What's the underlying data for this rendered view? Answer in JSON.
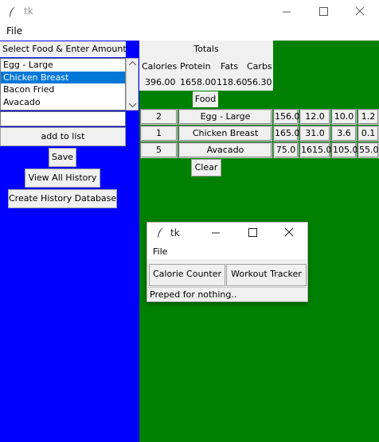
{
  "window": {
    "title": "tk",
    "menu_file": "File"
  },
  "left_panel": {
    "header": "Select Food & Enter Amount",
    "food_options": [
      "Egg - Large",
      "Chicken Breast",
      "Bacon Fried",
      "Avacado"
    ],
    "selected_index": 1,
    "amount_value": "",
    "add_button": "add to list",
    "save_button": "Save",
    "view_history_button": "View All History",
    "create_db_button": "Create History Database"
  },
  "totals": {
    "title": "Totals",
    "columns": [
      "Calories",
      "Protein",
      "Fats",
      "Carbs"
    ],
    "values": [
      "396.00",
      "1658.00",
      "118.60",
      "56.30"
    ]
  },
  "food_table": {
    "header": "Food",
    "rows": [
      {
        "qty": "2",
        "name": "Egg - Large",
        "cal": "156.0",
        "protein": "12.0",
        "fat": "10.0",
        "carb": "1.2"
      },
      {
        "qty": "1",
        "name": "Chicken Breast",
        "cal": "165.0",
        "protein": "31.0",
        "fat": "3.6",
        "carb": "0.1"
      },
      {
        "qty": "5",
        "name": "Avacado",
        "cal": "75.0",
        "protein": "1615.0",
        "fat": "105.0",
        "carb": "55.0"
      }
    ],
    "clear_button": "Clear"
  },
  "popup": {
    "title": "tk",
    "menu_file": "File",
    "calorie_button": "Calorie Counter",
    "workout_button": "Workout Tracker",
    "status": "Preped for nothing.."
  },
  "colors": {
    "left_bg": "#0000ff",
    "right_bg": "#008000",
    "selection": "#0078d7"
  }
}
